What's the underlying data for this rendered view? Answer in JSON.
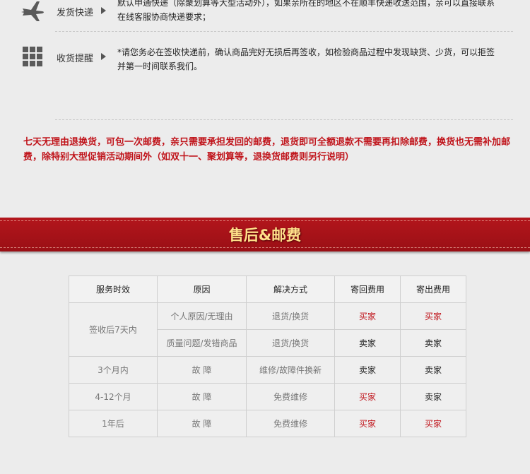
{
  "colors": {
    "accent_red": "#c0141b",
    "banner_bg": "#a81219",
    "banner_text": "#ffe08a"
  },
  "shipping_row": {
    "icon": "airplane-icon",
    "label": "发货快递",
    "text": "默认申通快递（除聚划算等大型活动外），如果亲所在的地区不在顺丰快递收送范围，亲可以直接联系在线客服协商快递要求；"
  },
  "receipt_row": {
    "icon": "grid-icon",
    "label": "收货提醒",
    "text": "*请您务必在签收快递前，确认商品完好无损后再签收，如检验商品过程中发现缺货、少货，可以拒签并第一时间联系我们。"
  },
  "notice": "七天无理由退换货，可包一次邮费，亲只需要承担发回的邮费，退货即可全额退款不需要再扣除邮费，换货也无需补加邮费，除特别大型促销活动期间外（如双十一、聚划算等，退换货邮费则另行说明）",
  "banner_title": "售后&邮费",
  "table": {
    "headers": [
      "服务时效",
      "原因",
      "解决方式",
      "寄回费用",
      "寄出费用"
    ],
    "group1": {
      "period": "签收后7天内",
      "rows": [
        {
          "reason": "个人原因/无理由",
          "solution": "退货/换货",
          "return_fee": "买家",
          "send_fee": "买家"
        },
        {
          "reason": "质量问题/发错商品",
          "solution": "退货/换货",
          "return_fee": "卖家",
          "send_fee": "卖家"
        }
      ]
    },
    "rows": [
      {
        "period": "3个月内",
        "reason": "故 障",
        "solution": "维修/故障件换新",
        "return_fee": "卖家",
        "send_fee": "卖家"
      },
      {
        "period": "4-12个月",
        "reason": "故 障",
        "solution": "免费维修",
        "return_fee": "买家",
        "send_fee": "卖家"
      },
      {
        "period": "1年后",
        "reason": "故 障",
        "solution": "免费维修",
        "return_fee": "买家",
        "send_fee": "买家"
      }
    ]
  }
}
